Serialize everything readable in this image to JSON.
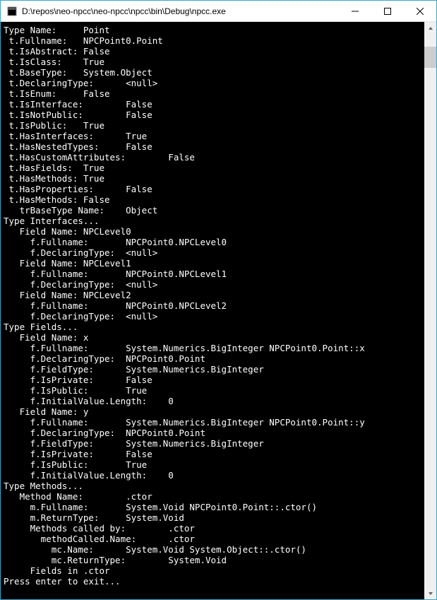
{
  "window": {
    "title": "D:\\repos\\neo-npcc\\neo-npcc\\npcc\\bin\\Debug\\npcc.exe"
  },
  "console_lines": [
    "Type Name:     Point",
    " t.Fullname:   NPCPoint0.Point",
    " t.IsAbstract: False",
    " t.IsClass:    True",
    " t.BaseType:   System.Object",
    " t.DeclaringType:      <null>",
    " t.IsEnum:     False",
    " t.IsInterface:        False",
    " t.IsNotPublic:        False",
    " t.IsPublic:   True",
    " t.HasInterfaces:      True",
    " t.HasNestedTypes:     False",
    " t.HasCustomAttributes:        False",
    " t.HasFields:  True",
    " t.HasMethods: True",
    " t.HasProperties:      False",
    " t.HasMethods: False",
    "   trBaseType Name:    Object",
    "Type Interfaces...",
    "   Field Name: NPCLevel0",
    "     f.Fullname:       NPCPoint0.NPCLevel0",
    "     f.DeclaringType:  <null>",
    "   Field Name: NPCLevel1",
    "     f.Fullname:       NPCPoint0.NPCLevel1",
    "     f.DeclaringType:  <null>",
    "   Field Name: NPCLevel2",
    "     f.Fullname:       NPCPoint0.NPCLevel2",
    "     f.DeclaringType:  <null>",
    "Type Fields...",
    "   Field Name: x",
    "     f.Fullname:       System.Numerics.BigInteger NPCPoint0.Point::x",
    "     f.DeclaringType:  NPCPoint0.Point",
    "     f.FieldType:      System.Numerics.BigInteger",
    "     f.IsPrivate:      False",
    "     f.IsPublic:       True",
    "     f.InitialValue.Length:    0",
    "   Field Name: y",
    "     f.Fullname:       System.Numerics.BigInteger NPCPoint0.Point::y",
    "     f.DeclaringType:  NPCPoint0.Point",
    "     f.FieldType:      System.Numerics.BigInteger",
    "     f.IsPrivate:      False",
    "     f.IsPublic:       True",
    "     f.InitialValue.Length:    0",
    "Type Methods...",
    "   Method Name:        .ctor",
    "     m.Fullname:       System.Void NPCPoint0.Point::.ctor()",
    "     m.ReturnType:     System.Void",
    "     Methods called by:        .ctor",
    "       methodCalled.Name:      .ctor",
    "         mc.Name:      System.Void System.Object::.ctor()",
    "         mc.ReturnType:        System.Void",
    "     Fields in .ctor",
    "Press enter to exit..."
  ]
}
